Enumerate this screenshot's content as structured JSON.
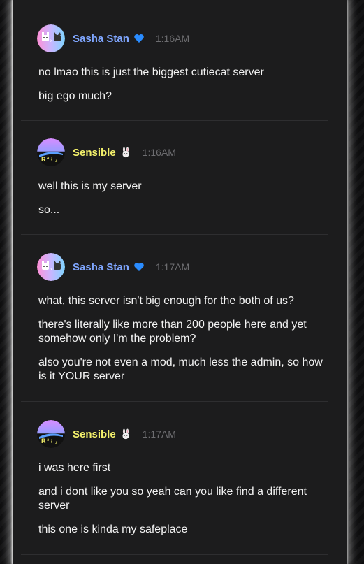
{
  "colors": {
    "panel_background": "#1c1c1d",
    "message_text": "#f2f2f2",
    "timestamp_text": "#6d6d70",
    "sasha_name": "#7fa6ff",
    "sensible_name": "#f3f06b",
    "heart_badge": "#2a8cff"
  },
  "messages": [
    {
      "author": "Sasha Stan",
      "badge": "blue-heart-icon",
      "time": "1:16AM",
      "lines": [
        "no lmao this is just the biggest cutiecat server",
        "big ego much?"
      ]
    },
    {
      "author": "Sensible",
      "badge": "rabbit-icon",
      "time": "1:16AM",
      "lines": [
        "well this is my server",
        "so..."
      ]
    },
    {
      "author": "Sasha Stan",
      "badge": "blue-heart-icon",
      "time": "1:17AM",
      "lines": [
        "what, this server isn't big enough for the both of us?",
        "there's literally like more than 200 people here and yet somehow only I'm the problem?",
        "also you're not even a mod, much less the admin, so how is it YOUR server"
      ]
    },
    {
      "author": "Sensible",
      "badge": "rabbit-icon",
      "time": "1:17AM",
      "lines": [
        "i was here first",
        "and i dont like you so yeah can you like find a different server",
        "this one is kinda my safeplace"
      ]
    }
  ]
}
